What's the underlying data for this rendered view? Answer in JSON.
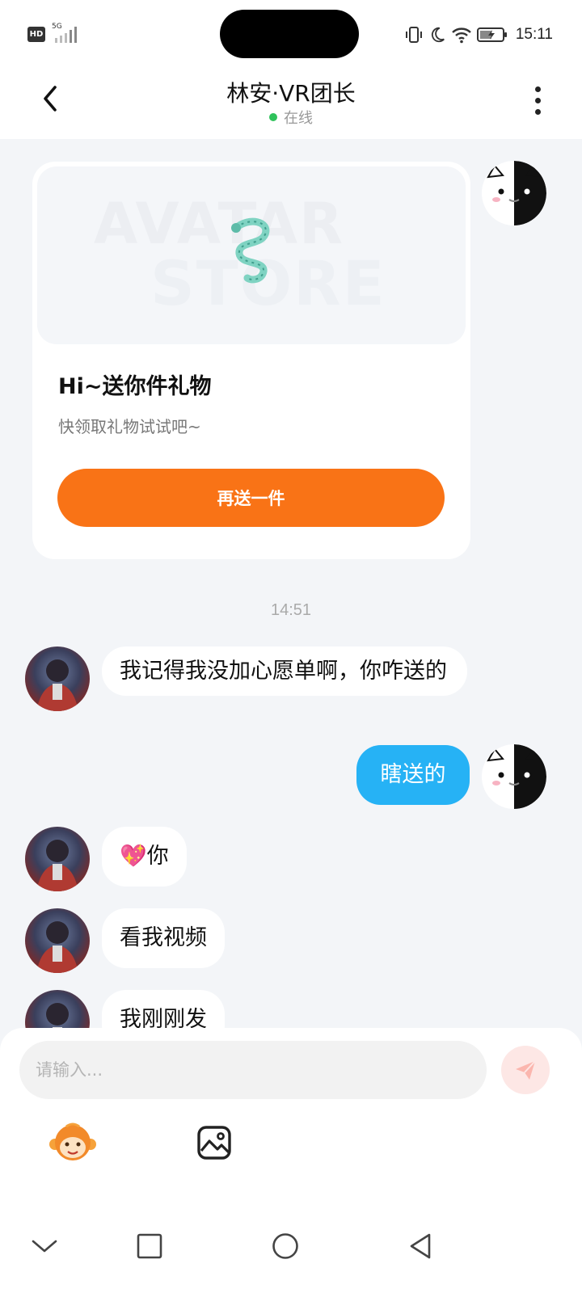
{
  "status_bar": {
    "hd_label": "HD",
    "network_label": "5G",
    "time": "15:11"
  },
  "header": {
    "title": "林安·VR团长",
    "status": "在线"
  },
  "gift_card": {
    "banner_text_1": "AVATAR",
    "banner_text_2": "STORE",
    "title": "Hi~送你件礼物",
    "subtitle": "快领取礼物试试吧~",
    "button_label": "再送一件"
  },
  "timestamp": "14:51",
  "messages": [
    {
      "from": "other",
      "text": "我记得我没加心愿单啊，你咋送的"
    },
    {
      "from": "me",
      "text": "瞎送的"
    },
    {
      "from": "other",
      "text": "💖你"
    },
    {
      "from": "other",
      "text": "看我视频"
    },
    {
      "from": "other",
      "text": "我刚刚发"
    }
  ],
  "composer": {
    "placeholder": "请输入..."
  },
  "colors": {
    "accent_orange": "#f97316",
    "outgoing_bubble": "#26b2f5",
    "online": "#2fc25b",
    "background": "#f3f5f8"
  }
}
